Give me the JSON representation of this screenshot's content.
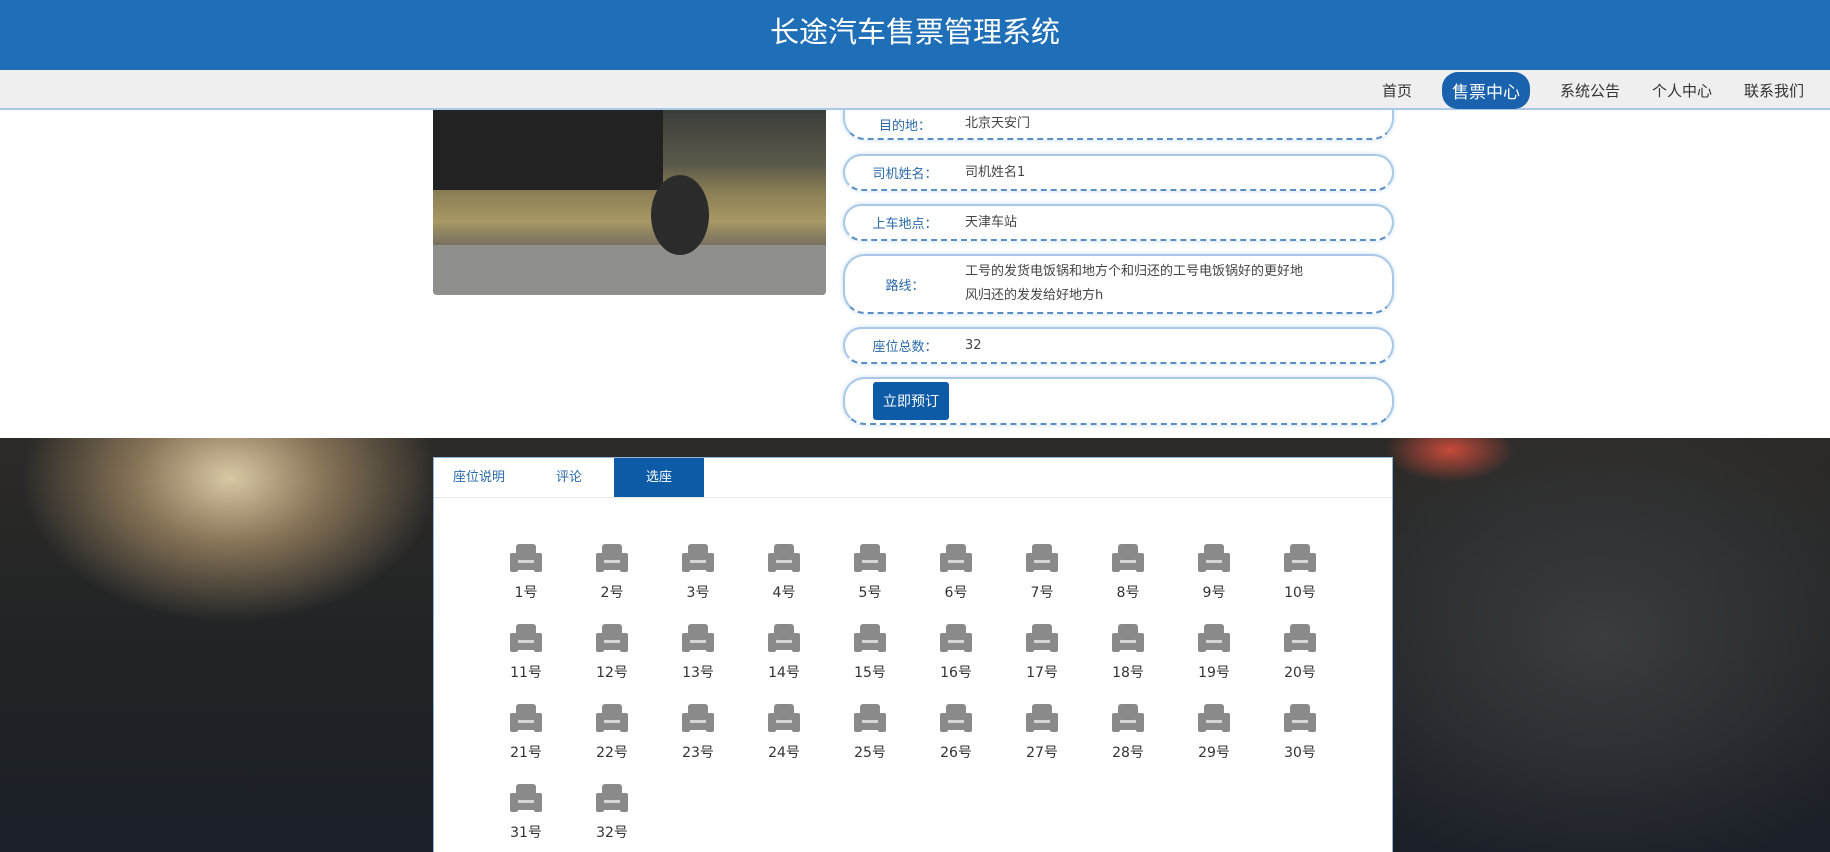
{
  "header": {
    "title": "长途汽车售票管理系统"
  },
  "nav": {
    "items": [
      {
        "label": "首页"
      },
      {
        "label": "售票中心",
        "active": true
      },
      {
        "label": "系统公告"
      },
      {
        "label": "个人中心"
      },
      {
        "label": "联系我们"
      }
    ]
  },
  "details": {
    "destination": {
      "label": "目的地：",
      "value": "北京天安门"
    },
    "driver": {
      "label": "司机姓名：",
      "value": "司机姓名1"
    },
    "boarding": {
      "label": "上车地点：",
      "value": "天津车站"
    },
    "route": {
      "label": "路线：",
      "value": "工号的发货电饭锅和地方个和归还的工号电饭锅好的更好地风归还的发发给好地方h"
    },
    "seats_total": {
      "label": "座位总数：",
      "value": "32"
    },
    "book_button": "立即预订"
  },
  "tabs": [
    {
      "label": "座位说明"
    },
    {
      "label": "评论"
    },
    {
      "label": "选座",
      "active": true
    }
  ],
  "seats": [
    "1号",
    "2号",
    "3号",
    "4号",
    "5号",
    "6号",
    "7号",
    "8号",
    "9号",
    "10号",
    "11号",
    "12号",
    "13号",
    "14号",
    "15号",
    "16号",
    "17号",
    "18号",
    "19号",
    "20号",
    "21号",
    "22号",
    "23号",
    "24号",
    "25号",
    "26号",
    "27号",
    "28号",
    "29号",
    "30号",
    "31号",
    "32号"
  ],
  "colors": {
    "primary": "#1f6fb8",
    "active": "#0d5aa7",
    "seat": "#8a8a8a"
  }
}
